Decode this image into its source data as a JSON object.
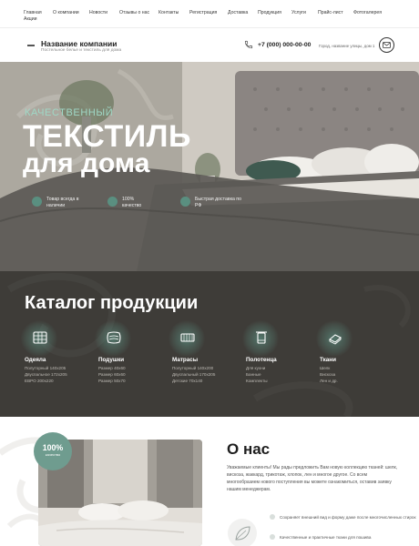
{
  "nav": {
    "items": [
      "Главная",
      "О компании",
      "Новости",
      "Отзывы о нас",
      "Контакты",
      "Регистрация",
      "Доставка",
      "Продукция",
      "Услуги",
      "Прайс-лист",
      "Фотогалерея",
      "Акции"
    ]
  },
  "header": {
    "company_name": "Название компании",
    "tagline": "Постельное белье и текстиль для дома",
    "phone": "+7 (000) 000-00-00",
    "address": "Город, название улицы, дом 1",
    "phone_icon": "phone-icon",
    "mail_icon": "mail-icon"
  },
  "hero": {
    "kicker": "КАЧЕСТВЕННЫЙ",
    "title_line1": "ТЕКСТИЛЬ",
    "title_line2": "для дома",
    "features": [
      {
        "text": "Товар всегда в наличии",
        "icon": "box-icon"
      },
      {
        "text": "100% качество",
        "icon": "quality-icon"
      },
      {
        "text": "Быстрая доставка по РФ",
        "icon": "truck-icon"
      }
    ]
  },
  "catalog": {
    "title": "Каталог продукции",
    "categories": [
      {
        "name": "Одеяла",
        "icon": "blanket-icon",
        "items": [
          "Полуторный 140х205",
          "Двуспальное 172х205",
          "ЕВРО 200х220"
        ]
      },
      {
        "name": "Подушки",
        "icon": "pillow-icon",
        "items": [
          "Размер 40х60",
          "Размер 60х60",
          "Размер 50х70"
        ]
      },
      {
        "name": "Матрасы",
        "icon": "mattress-icon",
        "items": [
          "Полуторный 140х200",
          "Двуспальный 170х205",
          "Детские 70х140"
        ]
      },
      {
        "name": "Полотенца",
        "icon": "towel-icon",
        "items": [
          "Для кухни",
          "Банные",
          "Комплекты"
        ]
      },
      {
        "name": "Ткани",
        "icon": "fabric-icon",
        "items": [
          "Шелк",
          "Вискоза",
          "Лен и др."
        ]
      }
    ]
  },
  "about": {
    "badge_big": "100%",
    "badge_small": "качество",
    "title": "О нас",
    "text": "Уважаемые клиенты! Мы рады предложить Вам новую коллекцию тканей: шелк, вискоза, жаккард, трикотаж, хлопок, лен и многое другое. Со всем многообразием нового поступления вы можете ознакомиться, оставив заявку нашим менеджерам.",
    "features": [
      "Сохраняет внешний вид и форму даже после многочисленных стирок",
      "Качественные и практичные ткани для пошива"
    ],
    "leaf_icon": "leaf-icon"
  },
  "colors": {
    "accent": "#6f9c8f",
    "accent_light": "#9fd8c6",
    "dark_section": "#3e3c38"
  }
}
